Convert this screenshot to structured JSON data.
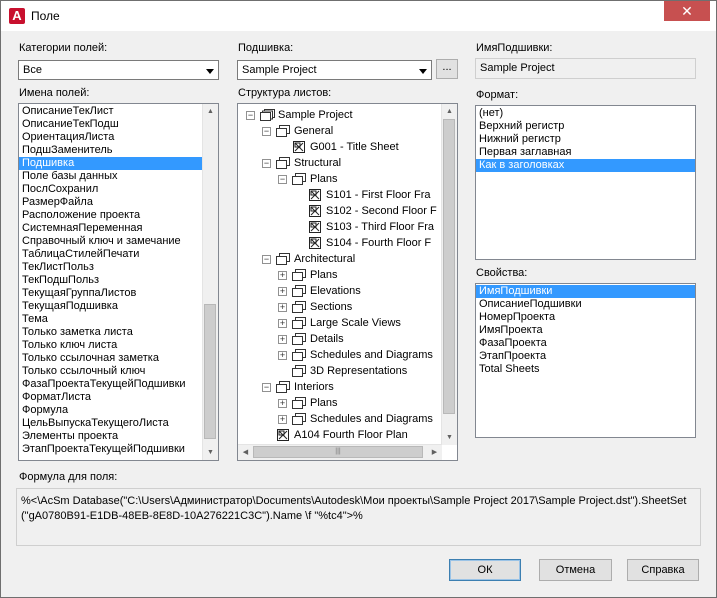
{
  "window": {
    "title": "Поле",
    "close_glyph": "✕",
    "app_icon": "A"
  },
  "categories": {
    "label": "Категории полей:",
    "selected": "Все"
  },
  "fieldnames": {
    "label": "Имена полей:",
    "items": [
      "ОписаниеТекЛист",
      "ОписаниеТекПодш",
      "ОриентацияЛиста",
      "ПодшЗаменитель",
      "Подшивка",
      "Поле базы данных",
      "ПослСохранил",
      "РазмерФайла",
      "Расположение проекта",
      "СистемнаяПеременная",
      "Справочный ключ и замечание",
      "ТаблицаСтилейПечати",
      "ТекЛистПольз",
      "ТекПодшПольз",
      "ТекущаяГруппаЛистов",
      "ТекущаяПодшивка",
      "Тема",
      "Только заметка листа",
      "Только ключ листа",
      "Только ссылочная заметка",
      "Только ссылочный ключ",
      "ФазаПроектаТекущейПодшивки",
      "ФорматЛиста",
      "Формула",
      "ЦельВыпускаТекущегоЛиста",
      "Элементы проекта",
      "ЭтапПроектаТекущейПодшивки"
    ],
    "selected": "Подшивка"
  },
  "sheetset": {
    "label": "Подшивка:",
    "selected": "Sample Project",
    "browse_label": "..."
  },
  "sheetset_name": {
    "label": "ИмяПодшивки:",
    "value": "Sample Project"
  },
  "tree": {
    "label": "Структура листов:",
    "nodes": [
      {
        "text": "Sample Project",
        "level": 0,
        "glyph": "−",
        "icon": "sheetset-icon"
      },
      {
        "text": "General",
        "level": 1,
        "glyph": "−",
        "icon": "group-icon"
      },
      {
        "text": "G001 - Title Sheet",
        "level": 2,
        "glyph": "",
        "icon": "sheet-icon"
      },
      {
        "text": "Structural",
        "level": 1,
        "glyph": "−",
        "icon": "group-icon"
      },
      {
        "text": "Plans",
        "level": 2,
        "glyph": "−",
        "icon": "group-icon"
      },
      {
        "text": "S101 - First Floor Fra",
        "level": 3,
        "glyph": "",
        "icon": "sheet-icon"
      },
      {
        "text": "S102 - Second Floor F",
        "level": 3,
        "glyph": "",
        "icon": "sheet-icon"
      },
      {
        "text": "S103 - Third Floor Fra",
        "level": 3,
        "glyph": "",
        "icon": "sheet-icon"
      },
      {
        "text": "S104 - Fourth Floor F",
        "level": 3,
        "glyph": "",
        "icon": "sheet-icon"
      },
      {
        "text": "Architectural",
        "level": 1,
        "glyph": "−",
        "icon": "group-icon"
      },
      {
        "text": "Plans",
        "level": 2,
        "glyph": "+",
        "icon": "group-icon"
      },
      {
        "text": "Elevations",
        "level": 2,
        "glyph": "+",
        "icon": "group-icon"
      },
      {
        "text": "Sections",
        "level": 2,
        "glyph": "+",
        "icon": "group-icon"
      },
      {
        "text": "Large Scale Views",
        "level": 2,
        "glyph": "+",
        "icon": "group-icon"
      },
      {
        "text": "Details",
        "level": 2,
        "glyph": "+",
        "icon": "group-icon"
      },
      {
        "text": "Schedules and Diagrams",
        "level": 2,
        "glyph": "+",
        "icon": "group-icon"
      },
      {
        "text": "3D Representations",
        "level": 2,
        "glyph": "",
        "icon": "group-icon"
      },
      {
        "text": "Interiors",
        "level": 1,
        "glyph": "−",
        "icon": "group-icon"
      },
      {
        "text": "Plans",
        "level": 2,
        "glyph": "+",
        "icon": "group-icon"
      },
      {
        "text": "Schedules and Diagrams",
        "level": 2,
        "glyph": "+",
        "icon": "group-icon"
      },
      {
        "text": "A104 Fourth Floor Plan",
        "level": 1,
        "glyph": "",
        "icon": "sheet-icon"
      }
    ]
  },
  "format": {
    "label": "Формат:",
    "items": [
      "(нет)",
      "Верхний регистр",
      "Нижний регистр",
      "Первая заглавная",
      "Как в заголовках"
    ],
    "selected": "Как в заголовках"
  },
  "properties": {
    "label": "Свойства:",
    "items": [
      "ИмяПодшивки",
      "ОписаниеПодшивки",
      "НомерПроекта",
      "ИмяПроекта",
      "ФазаПроекта",
      "ЭтапПроекта",
      "Total Sheets"
    ],
    "selected": "ИмяПодшивки"
  },
  "formula": {
    "label": "Формула для поля:",
    "text": "%<\\AcSm Database(\"C:\\Users\\Администратор\\Documents\\Autodesk\\Мои проекты\\Sample Project 2017\\Sample Project.dst\").SheetSet (\"gA0780B91-E1DB-48EB-8E8D-10A276221C3C\").Name \\f \"%tc4\">%"
  },
  "buttons": {
    "ok": "ОК",
    "cancel": "Отмена",
    "help": "Справка"
  },
  "colors": {
    "selection": "#3399ff",
    "close": "#c75050",
    "app_icon": "#c8102e"
  }
}
